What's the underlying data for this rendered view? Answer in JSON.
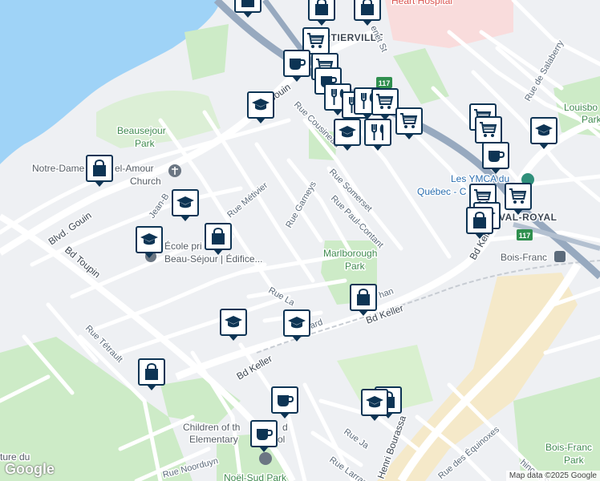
{
  "map": {
    "labels": {
      "cartierville": "CARTIERVILLE",
      "heart_hospital": "Heart Hospital",
      "beausejour_park_1": "Beausejour",
      "beausejour_park_2": "Park",
      "notre_dame_church_1": "Notre-Dame",
      "notre_dame_church_2": "el-Amour",
      "notre_dame_church_3": "Church",
      "boulevard_gouin_west": "Blvd. Gouin",
      "boulevard_gouin_north": "Bouin",
      "rue_jean": "Jean-B",
      "rue_metivier": "Rue Métivier",
      "rue_garneys": "Rue Garneys",
      "rue_somerset": "Rue Somerset",
      "rue_paul_contant": "Rue Paul-Contant",
      "rue_cousineau": "Rue Cousineau",
      "bd_toupin": "Bd Toupin",
      "ecole_1": "École pri",
      "ecole_2": "Beau-Séjour | Édifice...",
      "ecole_3": "re",
      "marlborough_park_1": "Marlborough",
      "marlborough_park_2": "Park",
      "rue_la": "Rue La",
      "rue_ard": "ard",
      "rue_chan": "han",
      "bd_keller_south": "Bd Keller",
      "bd_keller_west": "Bd Keller",
      "bd_keller_east": "Bd Keller",
      "rue_tetrault": "Rue Tétrault",
      "children_1": "Children of th",
      "children_2": "d",
      "children_3": "Elementary",
      "children_4": "ol",
      "culture_1": "ture du",
      "rue_noorduyn": "Rue Noorduyn",
      "noel_sud_park": "Noël-Sud Park",
      "rue_ja": "Rue Ja",
      "rue_larrance": "Rue Larrance",
      "henri_bourassa": "Henri Bourassa",
      "rue_equinoxes": "Rue des Équinoxes",
      "rue_nook": "hinook St",
      "les_ymca_1": "Les YMCA du",
      "les_ymca_2": "Québec - C",
      "val_royal": "VAL-ROYAL",
      "bois_franc_station": "Bois-Franc",
      "bois_franc_park_1": "Bois-Franc",
      "bois_franc_park_2": "Park",
      "rue_salaberry": "Rue de Salaberry",
      "louisbourg_1": "Louisbo",
      "louisbourg_2": "Park",
      "rue_jenet": "enet St",
      "route_117_north": "117",
      "route_117_east": "117"
    },
    "markers": [
      {
        "icon": "shopping-bag-icon"
      },
      {
        "icon": "shopping-bag-icon"
      },
      {
        "icon": "shopping-bag-icon"
      },
      {
        "icon": "shopping-cart-icon"
      },
      {
        "icon": "cafe-icon"
      },
      {
        "icon": "shopping-cart-icon"
      },
      {
        "icon": "cafe-icon"
      },
      {
        "icon": "restaurant-icon"
      },
      {
        "icon": "restaurant-icon"
      },
      {
        "icon": "restaurant-icon"
      },
      {
        "icon": "shopping-cart-icon"
      },
      {
        "icon": "school-icon"
      },
      {
        "icon": "restaurant-icon"
      },
      {
        "icon": "school-icon"
      },
      {
        "icon": "shopping-cart-icon"
      },
      {
        "icon": "shopping-cart-icon"
      },
      {
        "icon": "school-icon"
      },
      {
        "icon": "shopping-cart-icon"
      },
      {
        "icon": "cafe-icon"
      },
      {
        "icon": "shopping-cart-icon"
      },
      {
        "icon": "shopping-cart-icon"
      },
      {
        "icon": "school-icon"
      },
      {
        "icon": "shopping-bag-icon"
      },
      {
        "icon": "school-icon"
      },
      {
        "icon": "shopping-bag-icon"
      },
      {
        "icon": "school-icon"
      },
      {
        "icon": "shopping-bag-icon"
      },
      {
        "icon": "school-icon"
      },
      {
        "icon": "school-icon"
      },
      {
        "icon": "shopping-bag-icon"
      },
      {
        "icon": "shopping-bag-icon"
      },
      {
        "icon": "cafe-icon"
      },
      {
        "icon": "shopping-bag-icon"
      },
      {
        "icon": "school-icon"
      },
      {
        "icon": "cafe-icon"
      }
    ],
    "colors": {
      "water": "#9fd3f7",
      "park": "#cdebc7",
      "road": "#ffffff",
      "highway": "#97a9bf",
      "marker_border": "#0d3454",
      "industrial": "#f5e9c9"
    }
  },
  "footer": {
    "google_logo": "Google",
    "attribution": "Map data ©2025 Google"
  }
}
